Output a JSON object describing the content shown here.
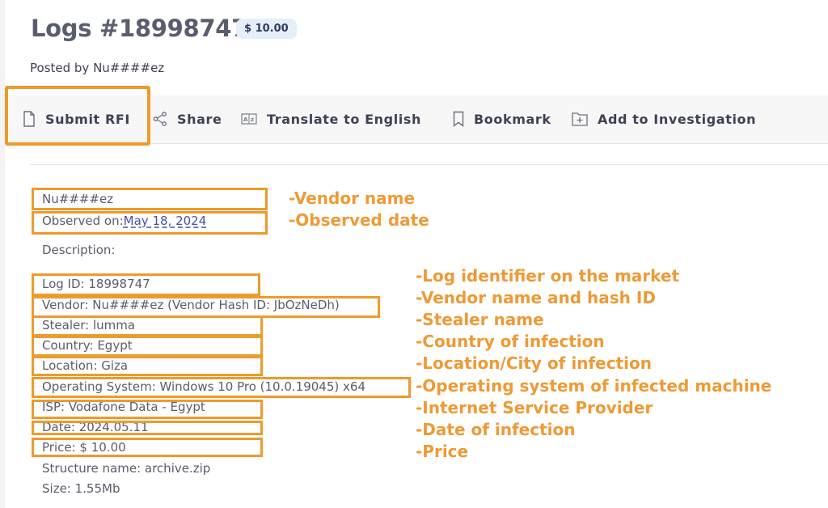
{
  "header": {
    "title": "Logs #18998747",
    "price_badge": "$ 10.00",
    "posted_by": "Posted by Nu####ez"
  },
  "toolbar": {
    "submit_rfi": "Submit RFI",
    "share": "Share",
    "translate": "Translate to English",
    "bookmark": "Bookmark",
    "add_to_investigation": "Add to Investigation"
  },
  "details": {
    "vendor_name": "Nu####ez",
    "observed_label": "Observed on:",
    "observed_date": "May 18, 2024",
    "description_label": "Description:",
    "log_id": "Log ID: 18998747",
    "vendor": "Vendor:  Nu####ez (Vendor Hash ID: JbOzNeDh)",
    "stealer": "Stealer: lumma",
    "country": "Country: Egypt",
    "location": "Location: Giza",
    "os": "Operating System: Windows 10 Pro (10.0.19045) x64",
    "isp": "ISP: Vodafone Data - Egypt",
    "date": "Date: 2024.05.11",
    "price": "Price: $ 10.00",
    "structure_name": "Structure name: archive.zip",
    "size": "Size: 1.55Mb"
  },
  "annotations": {
    "vendor_name": "-Vendor name",
    "observed_date": "-Observed date",
    "log_id": "-Log identifier on the market",
    "vendor": "-Vendor name and hash ID",
    "stealer": "-Stealer name",
    "country": "-Country of infection",
    "location": "-Location/City of infection",
    "os": "-Operating system of infected machine",
    "isp": "-Internet Service Provider",
    "date": "-Date of infection",
    "price": "-Price"
  },
  "colors": {
    "highlight": "#ef9a2b",
    "annotation_text": "#ee9a35",
    "badge_bg": "#e6eef8",
    "link": "#4651a8"
  }
}
